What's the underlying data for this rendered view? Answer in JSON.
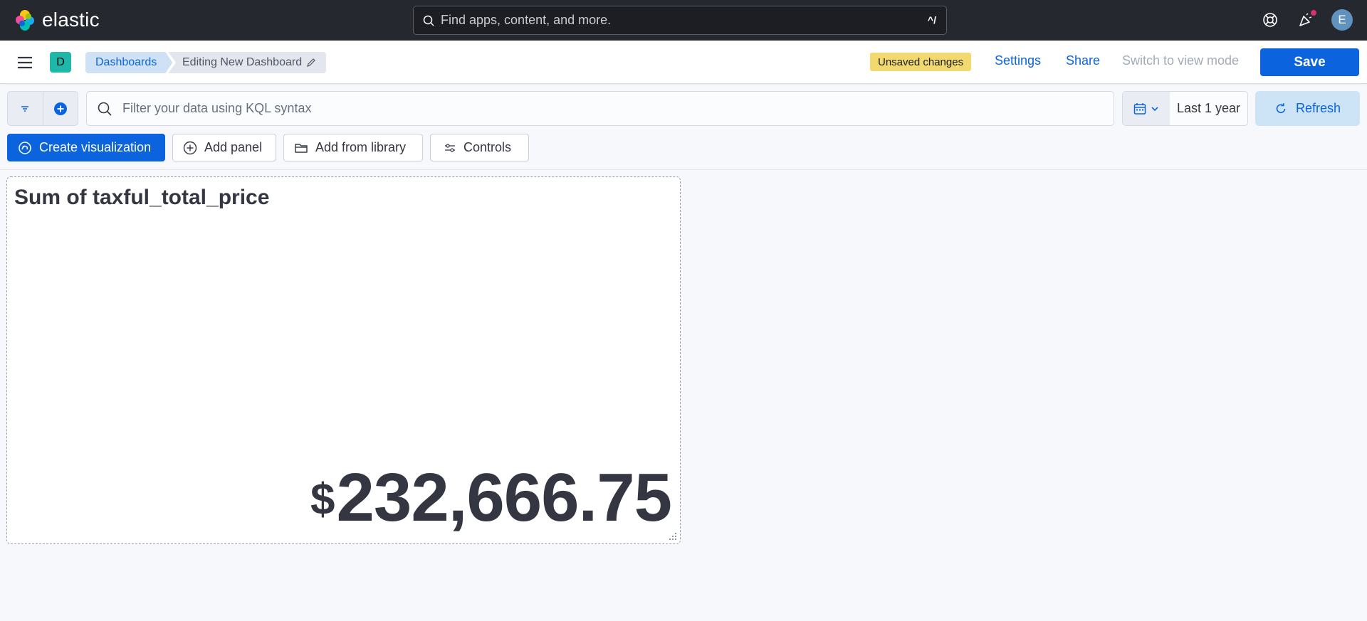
{
  "header": {
    "logo_text": "elastic",
    "search_placeholder": "Find apps, content, and more.",
    "search_shortcut": "^/",
    "avatar_initial": "E"
  },
  "appbar": {
    "space_initial": "D",
    "breadcrumbs": [
      "Dashboards",
      "Editing New Dashboard"
    ],
    "unsaved_badge": "Unsaved changes",
    "settings_label": "Settings",
    "share_label": "Share",
    "switch_mode_label": "Switch to view mode",
    "save_label": "Save"
  },
  "query_bar": {
    "kql_placeholder": "Filter your data using KQL syntax",
    "date_range": "Last 1 year",
    "refresh_label": "Refresh"
  },
  "toolbar": {
    "create_visualization": "Create visualization",
    "add_panel": "Add panel",
    "add_from_library": "Add from library",
    "controls": "Controls"
  },
  "panel": {
    "title": "Sum of taxful_total_price",
    "currency": "$",
    "value": "232,666.75"
  },
  "colors": {
    "header_bg": "#25282f",
    "primary": "#0b64dd",
    "unsaved": "#f1d86f",
    "refresh_bg": "#cce4f5",
    "space_badge": "#1fb8a8"
  }
}
